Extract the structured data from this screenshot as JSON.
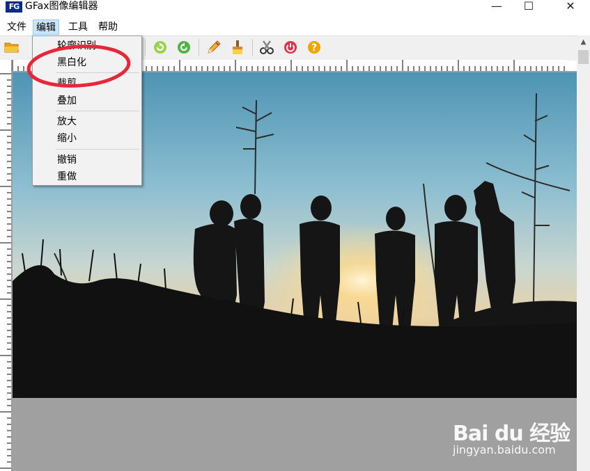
{
  "window": {
    "title": "GFax图像编辑器",
    "app_icon_text": "FG",
    "minimize": "—",
    "maximize": "☐",
    "close": "✕"
  },
  "menubar": {
    "items": [
      "文件",
      "编辑",
      "工具",
      "帮助"
    ],
    "active": "编辑"
  },
  "edit_menu": {
    "items": [
      "轮廓识别",
      "黑白化",
      "裁剪",
      "叠加",
      "放大",
      "缩小",
      "撤销",
      "重做"
    ],
    "highlighted": "黑白化"
  },
  "toolbar": {
    "icons": [
      "open-folder-icon",
      "rotate-left-icon",
      "rotate-right-icon",
      "pencil-icon",
      "brush-icon",
      "scissors-icon",
      "power-icon",
      "help-icon"
    ]
  },
  "annotation": {
    "color": "#e8283a"
  },
  "watermark": {
    "logo": "Bai du 经验",
    "url": "jingyan.baidu.com"
  },
  "colors": {
    "menu_highlight": "#cce4f7",
    "canvas_background": "#a0a0a0"
  }
}
